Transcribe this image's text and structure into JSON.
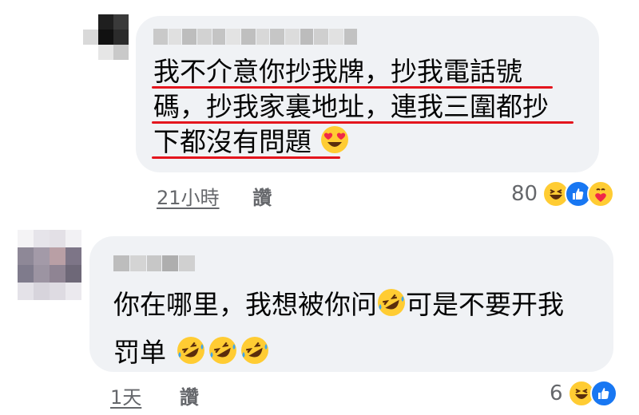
{
  "comments": [
    {
      "lines": [
        "我不介意你抄我牌，抄我電話號",
        "碼，抄我家裏地址，連我三圍都抄",
        "下都沒有問題"
      ],
      "trailing_emoji": "heart-eyes-emoji",
      "time": "21小時",
      "like_label": "讚",
      "reaction_count": "80",
      "reactions": [
        "haha",
        "like",
        "care"
      ]
    },
    {
      "lines": [
        "你在哪里，我想被你问",
        "可是不要开我",
        "罚单"
      ],
      "inline_emoji": "rolling-laughing-emoji",
      "time": "1天",
      "like_label": "讚",
      "reaction_count": "6",
      "reactions": [
        "haha",
        "like"
      ]
    }
  ],
  "colors": {
    "bubble": "#f0f2f5",
    "underline": "#e4151d",
    "meta": "#65676b",
    "like_blue": "#1877f2",
    "emoji_yellow": "#ffcc33"
  }
}
